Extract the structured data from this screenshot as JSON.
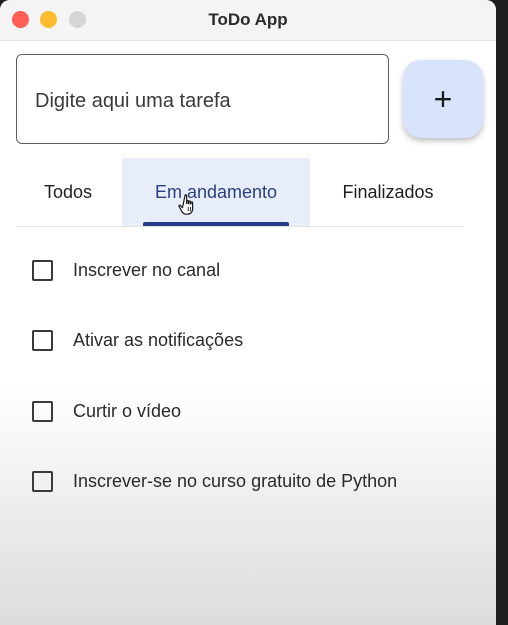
{
  "window": {
    "title": "ToDo App"
  },
  "input": {
    "placeholder": "Digite aqui uma tarefa",
    "value": ""
  },
  "add_button": {
    "icon": "plus-icon",
    "label": "+"
  },
  "tabs": [
    {
      "label": "Todos",
      "selected": false
    },
    {
      "label": "Em andamento",
      "selected": true
    },
    {
      "label": "Finalizados",
      "selected": false
    }
  ],
  "tasks": [
    {
      "label": "Inscrever no canal",
      "checked": false
    },
    {
      "label": "Ativar as notificações",
      "checked": false
    },
    {
      "label": "Curtir o vídeo",
      "checked": false
    },
    {
      "label": "Inscrever-se no curso gratuito de Python",
      "checked": false
    }
  ],
  "colors": {
    "accent": "#233b86",
    "selected_tab_bg": "#e8eef9",
    "add_button_bg": "#d8e4fb",
    "close": "#ff5f57",
    "minimize": "#febc2e"
  }
}
